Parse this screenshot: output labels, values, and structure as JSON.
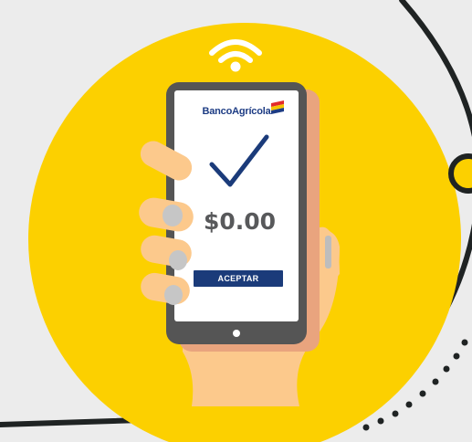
{
  "brand": {
    "name": "BancoAgrícola",
    "accent": "#1b3b7a",
    "logo_colors": [
      "#e32b2b",
      "#f5c400",
      "#1d3c84"
    ]
  },
  "screen": {
    "amount": "$0.00",
    "button_label": "ACEPTAR",
    "status_icon": "checkmark-icon"
  },
  "icons": {
    "signal": "wifi-icon",
    "home": "home-button-icon"
  },
  "colors": {
    "background": "#ececec",
    "circle": "#fcd000",
    "phone_frame": "#555555",
    "hand": "#fcc98c",
    "outline": "#1f2323"
  }
}
